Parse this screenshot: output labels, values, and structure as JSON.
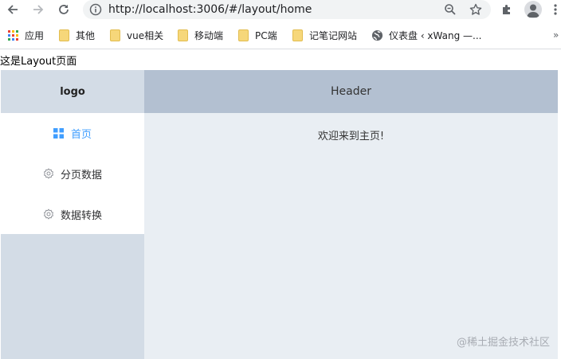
{
  "browser": {
    "url": "http://localhost:3006/#/layout/home",
    "bookmarks": [
      {
        "label": "应用",
        "icon": "apps-icon"
      },
      {
        "label": "其他",
        "icon": "folder-icon"
      },
      {
        "label": "vue相关",
        "icon": "folder-icon"
      },
      {
        "label": "移动端",
        "icon": "folder-icon"
      },
      {
        "label": "PC端",
        "icon": "folder-icon"
      },
      {
        "label": "记笔记网站",
        "icon": "folder-icon"
      },
      {
        "label": "仪表盘 ‹ xWang —...",
        "icon": "globe-icon"
      }
    ],
    "more_label": "»"
  },
  "page": {
    "caption": "这是Layout页面"
  },
  "sidebar": {
    "logo": "logo",
    "menu": [
      {
        "label": "首页",
        "icon": "grid-icon",
        "active": true
      },
      {
        "label": "分页数据",
        "icon": "gear-icon",
        "active": false
      },
      {
        "label": "数据转换",
        "icon": "gear-icon",
        "active": false
      }
    ]
  },
  "header": {
    "title": "Header"
  },
  "main": {
    "welcome": "欢迎来到主页!"
  },
  "watermark": "@稀土掘金技术社区",
  "colors": {
    "sidebar_bg": "#d3dce6",
    "header_bg": "#b3c0d1",
    "main_bg": "#e9eef3",
    "active": "#409eff"
  }
}
